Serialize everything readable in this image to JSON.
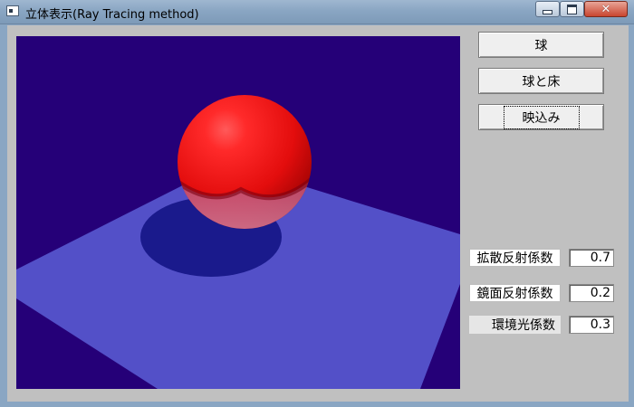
{
  "window": {
    "title": "立体表示(Ray Tracing method)"
  },
  "buttons": {
    "sphere": "球",
    "sphere_floor": "球と床",
    "reflection": "映込み"
  },
  "coefficients": [
    {
      "label": "拡散反射係数",
      "value": "0.7"
    },
    {
      "label": "鏡面反射係数",
      "value": "0.2"
    },
    {
      "label": "環境光係数",
      "value": "0.3"
    }
  ],
  "scene_colors": {
    "background": "#250078",
    "floor": "#5350c8",
    "shadow": "#1a1a8c",
    "sphere": "#e81010"
  }
}
